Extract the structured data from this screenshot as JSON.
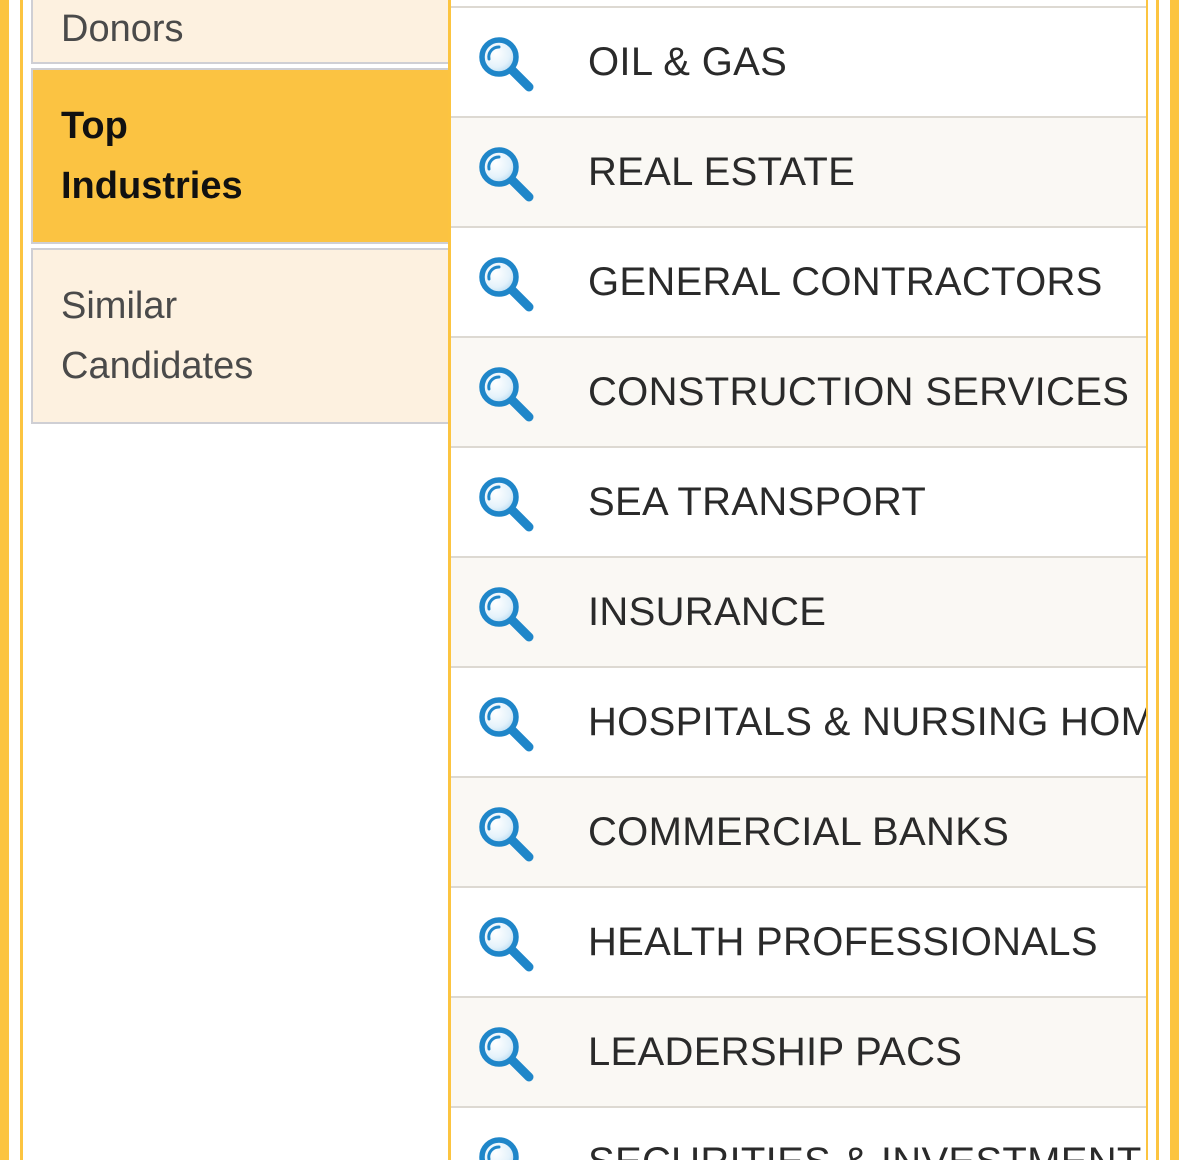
{
  "sidebar": {
    "tabs": [
      {
        "lines": [
          "Donors"
        ],
        "active": false
      },
      {
        "lines": [
          "Top",
          "Industries"
        ],
        "active": true
      },
      {
        "lines": [
          "Similar",
          "Candidates"
        ],
        "active": false
      }
    ]
  },
  "industries": {
    "icon": "magnifier-icon",
    "items": [
      "OIL & GAS",
      "REAL ESTATE",
      "GENERAL CONTRACTORS",
      "CONSTRUCTION SERVICES",
      "SEA TRANSPORT",
      "INSURANCE",
      "HOSPITALS & NURSING HOMES",
      "COMMERCIAL BANKS",
      "HEALTH PROFESSIONALS",
      "LEADERSHIP PACS",
      "SECURITIES & INVESTMENT"
    ]
  },
  "colors": {
    "accent": "#fcc440",
    "tab_inactive": "#fdf1e0",
    "icon_blue": "#1f86c9"
  }
}
